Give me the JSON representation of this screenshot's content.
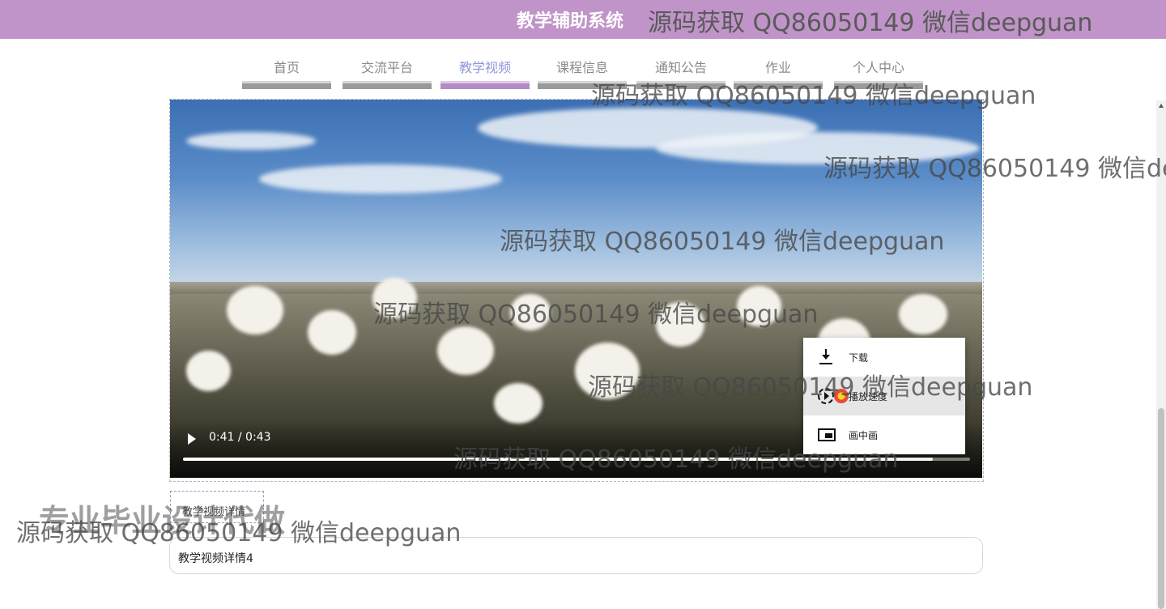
{
  "header": {
    "system_title": "教学辅助系统",
    "watermark": "源码获取 QQ86050149 微信deepguan"
  },
  "nav": {
    "items": [
      {
        "label": "首页"
      },
      {
        "label": "交流平台"
      },
      {
        "label": "教学视频",
        "active": true
      },
      {
        "label": "课程信息"
      },
      {
        "label": "通知公告"
      },
      {
        "label": "作业"
      },
      {
        "label": "个人中心"
      }
    ],
    "active_color": "#b08cc4"
  },
  "video": {
    "time_display": "0:41 / 0:43",
    "progress_fraction": 0.953,
    "context_menu": {
      "items": [
        {
          "label": "下载",
          "icon": "download-icon"
        },
        {
          "label": "播放速度",
          "icon": "playback-speed-icon"
        },
        {
          "label": "画中画",
          "icon": "picture-in-picture-icon"
        }
      ]
    }
  },
  "detail": {
    "tab_label": "教学视频详情",
    "content": "教学视频详情4"
  },
  "watermarks": {
    "text": "源码获取 QQ86050149 微信deepguan",
    "promo": "专业毕业设计代做"
  },
  "colors": {
    "header_bg": "#c094c8",
    "nav_active_text": "#8f97d8"
  }
}
